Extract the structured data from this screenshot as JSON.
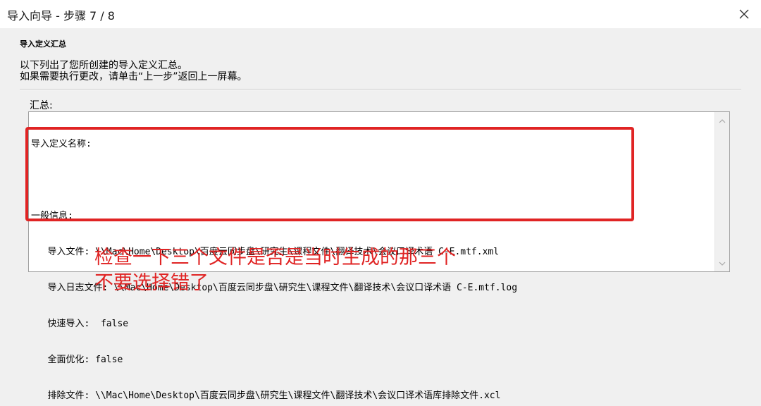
{
  "window": {
    "title": "导入向导 - 步骤 7 / 8"
  },
  "header": {
    "heading": "导入定义汇总",
    "line1": "以下列出了您所创建的导入定义汇总。",
    "line2": "如果需要执行更改，请单击“上一步”返回上一屏幕。"
  },
  "summary": {
    "label": "汇总:",
    "lines": [
      "导入定义名称:",
      "",
      "一般信息:",
      "   导入文件: \\\\Mac\\Home\\Desktop\\百度云同步盘\\研究生\\课程文件\\翻译技术\\会议口译术语 C-E.mtf.xml",
      "   导入日志文件: \\\\Mac\\Home\\Desktop\\百度云同步盘\\研究生\\课程文件\\翻译技术\\会议口译术语 C-E.mtf.log",
      "   快速导入:  false",
      "   全面优化: false",
      "   排除文件: \\\\Mac\\Home\\Desktop\\百度云同步盘\\研究生\\课程文件\\翻译技术\\会议口译术语库排除文件.xcl"
    ]
  },
  "annotation": {
    "line1": "检查一下三个文件是否是当时生成的那三个",
    "line2": "不要选择错了"
  },
  "icons": {
    "close": "close-icon",
    "scroll_up": "chevron-up-icon",
    "scroll_down": "chevron-down-icon"
  },
  "colors": {
    "annotation": "#e02424",
    "window_bg": "#f0f0f0",
    "titlebar_bg": "#ffffff"
  }
}
